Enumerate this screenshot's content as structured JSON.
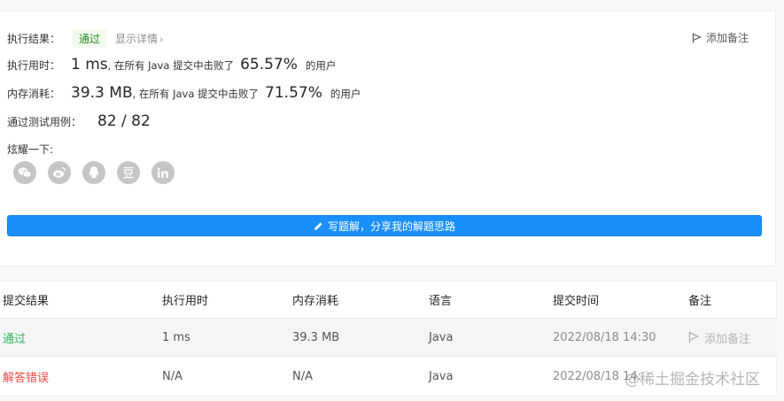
{
  "result": {
    "label": "执行结果：",
    "status": "通过",
    "detail_link": "显示详情",
    "add_note": "添加备注"
  },
  "runtime": {
    "label": "执行用时：",
    "value": "1 ms",
    "beat_text": ", 在所有 Java 提交中击败了",
    "percent": "65.57%",
    "users": "的用户"
  },
  "memory": {
    "label": "内存消耗：",
    "value": "39.3 MB",
    "beat_text": ", 在所有 Java 提交中击败了",
    "percent": "71.57%",
    "users": "的用户"
  },
  "tests": {
    "label": "通过测试用例：",
    "value": "82 / 82"
  },
  "share": {
    "label": "炫耀一下:",
    "icons": [
      "wechat-icon",
      "weibo-icon",
      "qq-icon",
      "douban-icon",
      "linkedin-icon"
    ]
  },
  "write_button": "写题解，分享我的解题思路",
  "table": {
    "headers": [
      "提交结果",
      "执行用时",
      "内存消耗",
      "语言",
      "提交时间",
      "备注"
    ],
    "rows": [
      {
        "status": "通过",
        "runtime": "1 ms",
        "memory": "39.3 MB",
        "language": "Java",
        "time": "2022/08/18 14:30",
        "note": "添加备注"
      },
      {
        "status": "解答错误",
        "runtime": "N/A",
        "memory": "N/A",
        "language": "Java",
        "time": "2022/08/18 14:",
        "note": ""
      }
    ]
  },
  "watermark": "@稀土掘金技术社区",
  "colors": {
    "accent": "#1a90ff",
    "pass": "#2db55d",
    "fail": "#ef4743"
  }
}
